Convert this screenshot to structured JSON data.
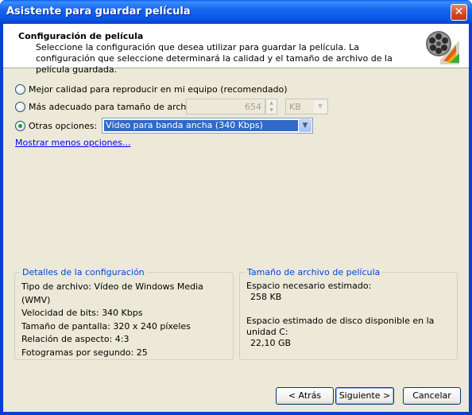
{
  "window": {
    "title": "Asistente para guardar película",
    "close_glyph": "✕"
  },
  "header": {
    "title": "Configuración de película",
    "description": "Seleccione la configuración que desea utilizar para guardar la película. La configuración que seleccione determinará la calidad y el tamaño de archivo de la película guardada.",
    "icon": "film-reel-icon"
  },
  "options": {
    "best_quality_label": "Mejor calidad para reproducir en mi equipo (recomendado)",
    "best_file_size_label": "Más adecuado para tamaño de archivo:",
    "file_size_value": "654",
    "file_size_unit": "KB",
    "other_label": "Otras opciones:",
    "other_selected": "Vídeo para banda ancha (340 Kbps)",
    "selected_option": "other",
    "show_less_link": "Mostrar menos opciones..."
  },
  "details": {
    "legend": "Detalles de la configuración",
    "lines": [
      "Tipo de archivo: Vídeo de Windows Media (WMV)",
      "Velocidad de bits: 340 Kbps",
      "Tamaño de pantalla: 320 x 240 píxeles",
      "Relación de aspecto: 4:3",
      "Fotogramas por segundo: 25"
    ]
  },
  "filesize": {
    "legend": "Tamaño de archivo de película",
    "estimated_label": "Espacio necesario estimado:",
    "estimated_value": "258 KB",
    "disk_label": "Espacio estimado de disco disponible en la unidad C:",
    "disk_value": "22,10 GB"
  },
  "buttons": {
    "back": "< Atrás",
    "next": "Siguiente >",
    "cancel": "Cancelar"
  },
  "colors": {
    "accent": "#0046d5",
    "selection": "#316ac5",
    "dialog_bg": "#ece9d8"
  }
}
